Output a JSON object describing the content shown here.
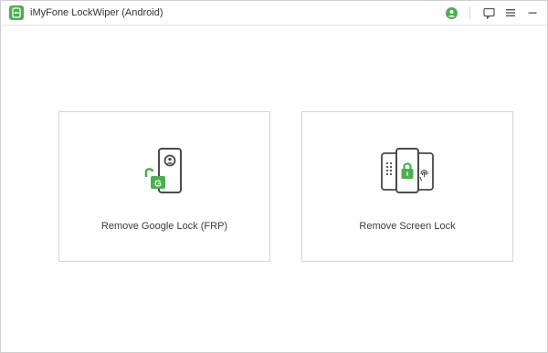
{
  "app": {
    "title": "iMyFone LockWiper (Android)",
    "accent_color": "#4caf50",
    "logo_icon": "lockwiper-logo-icon"
  },
  "titlebar": {
    "icons": [
      "account-icon",
      "feedback-icon",
      "menu-icon",
      "minimize-icon"
    ]
  },
  "options": [
    {
      "label": "Remove Google Lock (FRP)",
      "icon": "google-lock-phone-icon"
    },
    {
      "label": "Remove Screen Lock",
      "icon": "screen-lock-phones-icon"
    }
  ]
}
